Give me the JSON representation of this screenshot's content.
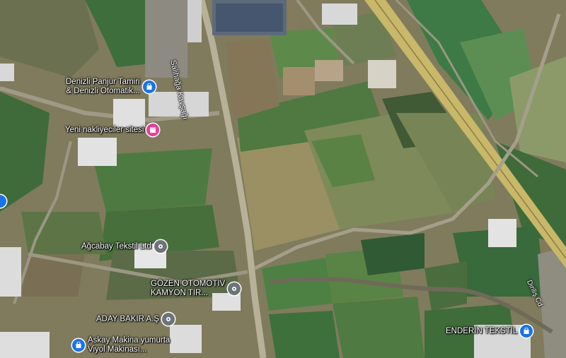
{
  "map": {
    "type": "satellite",
    "road_labels": {
      "salihaga": "Salihağa Kavşağı",
      "dirilis": "Diriliş Cd"
    },
    "pois": {
      "denizli_panjur": {
        "line1": "Denizli Panjur Tamiri",
        "line2": "& Denizli Otomatik...",
        "icon": "shopping-bag-icon",
        "color": "#1a73e8"
      },
      "yeni_nakliyeciler": {
        "line1": "Yeni nakliyeciler sitesi",
        "icon": "store-icon",
        "color": "#e43f9e"
      },
      "agcabay": {
        "line1": "Ağcabay Tekstil Ltd",
        "icon": "place-icon",
        "color": "#6d7378"
      },
      "gozen": {
        "line1": "GÖZEN OTOMOTİV",
        "line2": "KAMYON TIR...",
        "icon": "place-icon",
        "color": "#6d7378"
      },
      "aday": {
        "line1": "ADAY BAKIR A.Ş",
        "icon": "place-icon",
        "color": "#6d7378"
      },
      "askay": {
        "line1": "Askay Makina yumurta",
        "line2": "Viyol Makinası...",
        "icon": "shopping-bag-icon",
        "color": "#1a73e8"
      },
      "enderin": {
        "line1": "ENDERİN TEKSTİL",
        "icon": "shopping-bag-icon",
        "color": "#1a73e8"
      }
    }
  }
}
